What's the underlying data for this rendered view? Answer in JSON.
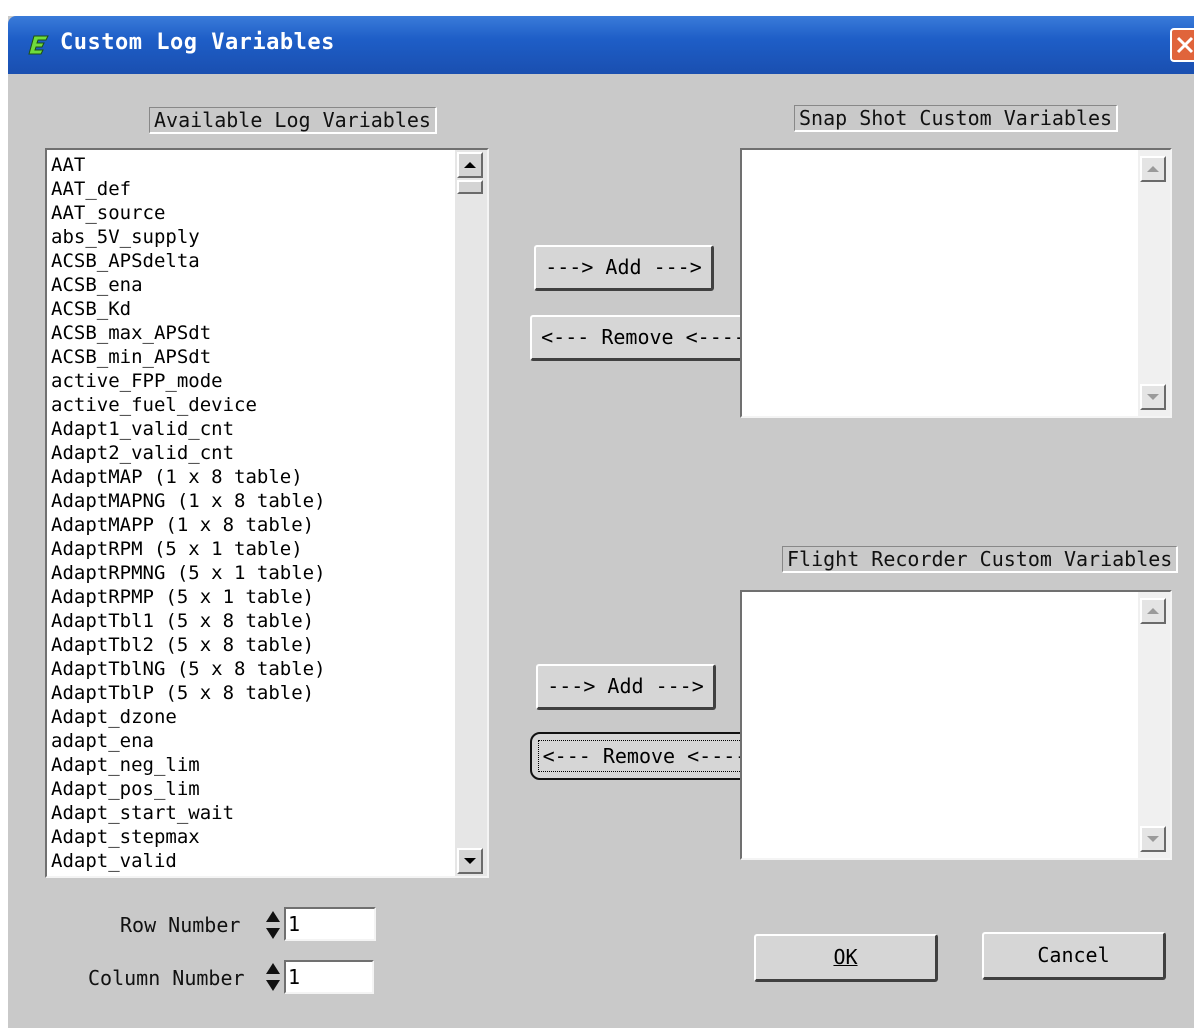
{
  "window": {
    "title": "Custom Log Variables"
  },
  "available": {
    "label": "Available Log Variables",
    "items": [
      "AAT",
      "AAT_def",
      "AAT_source",
      "abs_5V_supply",
      "ACSB_APSdelta",
      "ACSB_ena",
      "ACSB_Kd",
      "ACSB_max_APSdt",
      "ACSB_min_APSdt",
      "active_FPP_mode",
      "active_fuel_device",
      "Adapt1_valid_cnt",
      "Adapt2_valid_cnt",
      "AdaptMAP (1 x 8 table)",
      "AdaptMAPNG (1 x 8 table)",
      "AdaptMAPP (1 x 8 table)",
      "AdaptRPM (5 x 1 table)",
      "AdaptRPMNG (5 x 1 table)",
      "AdaptRPMP (5 x 1 table)",
      "AdaptTbl1 (5 x 8 table)",
      "AdaptTbl2 (5 x 8 table)",
      "AdaptTblNG (5 x 8 table)",
      "AdaptTblP (5 x 8 table)",
      "Adapt_dzone",
      "adapt_ena",
      "Adapt_neg_lim",
      "Adapt_pos_lim",
      "Adapt_start_wait",
      "Adapt_stepmax",
      "Adapt_valid"
    ]
  },
  "snapshot": {
    "label": "Snap Shot Custom Variables",
    "add_label": "---> Add --->",
    "remove_label": "<--- Remove <----",
    "items": []
  },
  "flight": {
    "label": "Flight Recorder Custom Variables",
    "add_label": "---> Add --->",
    "remove_label": "<--- Remove <----",
    "items": []
  },
  "row": {
    "label": "Row Number",
    "value": "1"
  },
  "column": {
    "label": "Column Number",
    "value": "1"
  },
  "buttons": {
    "ok": "OK",
    "cancel": "Cancel"
  }
}
